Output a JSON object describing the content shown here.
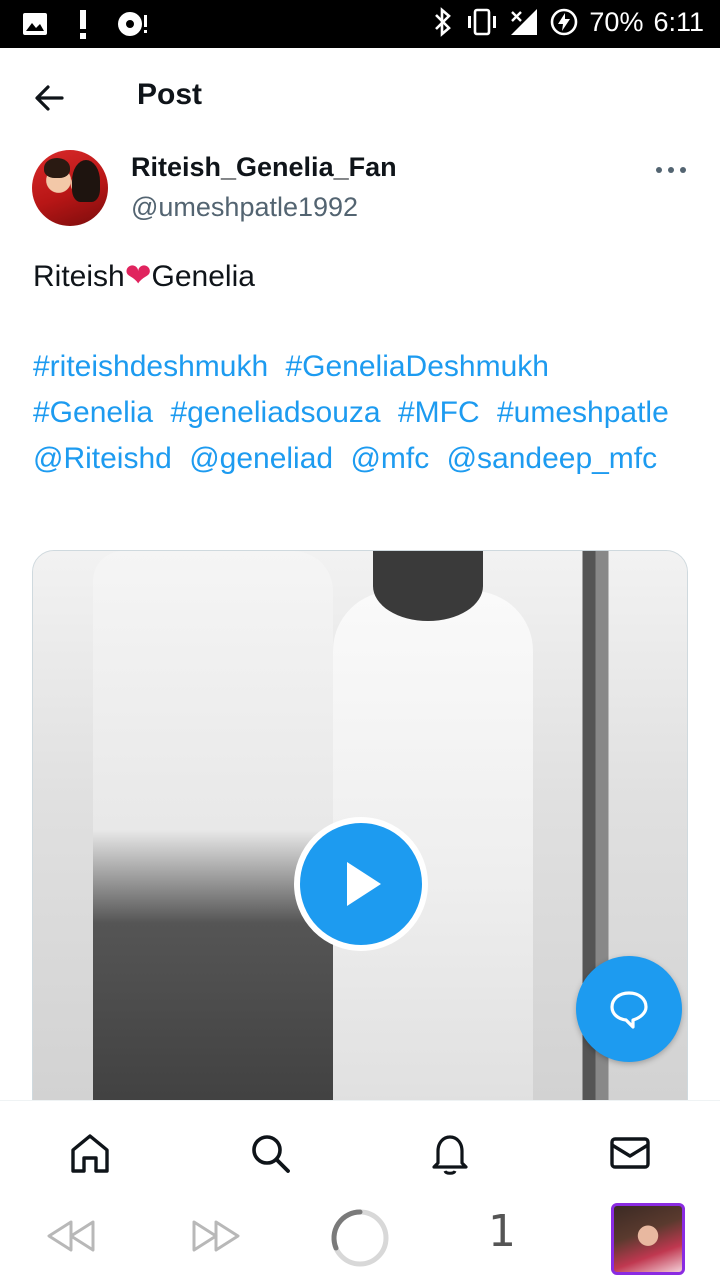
{
  "status_bar": {
    "battery": "70%",
    "time": "6:11"
  },
  "header": {
    "title": "Post"
  },
  "author": {
    "name": "Riteish_Genelia_Fan",
    "handle": "@umeshpatle1992"
  },
  "post": {
    "text_before": "Riteish",
    "heart": "❤",
    "text_after": "Genelia",
    "tags": [
      "#riteishdeshmukh",
      "#GeneliaDeshmukh",
      "#Genelia",
      "#geneliadsouza",
      "#MFC",
      "#umeshpatle",
      "@Riteishd",
      "@geneliad",
      "@mfc",
      "@sandeep_mfc"
    ]
  },
  "browser": {
    "tab_count": "1"
  },
  "colors": {
    "accent": "#1d9bf0",
    "text": "#0f1419",
    "secondary_text": "#536471"
  },
  "icons": {
    "status_left": [
      "image-icon",
      "alert-icon",
      "disc-icon"
    ],
    "status_right": [
      "bluetooth-icon",
      "vibrate-icon",
      "signal-icon",
      "battery-charging-icon"
    ],
    "nav": [
      "home-icon",
      "search-icon",
      "bell-icon",
      "mail-icon"
    ],
    "browser": [
      "rewind-icon",
      "forward-icon",
      "loading-icon"
    ]
  }
}
